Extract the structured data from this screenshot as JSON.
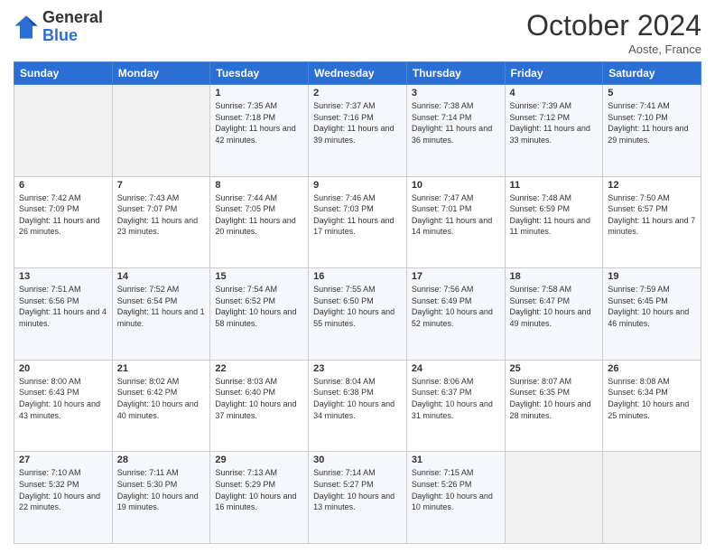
{
  "header": {
    "logo_line1": "General",
    "logo_line2": "Blue",
    "month": "October 2024",
    "location": "Aoste, France"
  },
  "weekdays": [
    "Sunday",
    "Monday",
    "Tuesday",
    "Wednesday",
    "Thursday",
    "Friday",
    "Saturday"
  ],
  "weeks": [
    [
      {
        "day": "",
        "sunrise": "",
        "sunset": "",
        "daylight": ""
      },
      {
        "day": "",
        "sunrise": "",
        "sunset": "",
        "daylight": ""
      },
      {
        "day": "1",
        "sunrise": "Sunrise: 7:35 AM",
        "sunset": "Sunset: 7:18 PM",
        "daylight": "Daylight: 11 hours and 42 minutes."
      },
      {
        "day": "2",
        "sunrise": "Sunrise: 7:37 AM",
        "sunset": "Sunset: 7:16 PM",
        "daylight": "Daylight: 11 hours and 39 minutes."
      },
      {
        "day": "3",
        "sunrise": "Sunrise: 7:38 AM",
        "sunset": "Sunset: 7:14 PM",
        "daylight": "Daylight: 11 hours and 36 minutes."
      },
      {
        "day": "4",
        "sunrise": "Sunrise: 7:39 AM",
        "sunset": "Sunset: 7:12 PM",
        "daylight": "Daylight: 11 hours and 33 minutes."
      },
      {
        "day": "5",
        "sunrise": "Sunrise: 7:41 AM",
        "sunset": "Sunset: 7:10 PM",
        "daylight": "Daylight: 11 hours and 29 minutes."
      }
    ],
    [
      {
        "day": "6",
        "sunrise": "Sunrise: 7:42 AM",
        "sunset": "Sunset: 7:09 PM",
        "daylight": "Daylight: 11 hours and 26 minutes."
      },
      {
        "day": "7",
        "sunrise": "Sunrise: 7:43 AM",
        "sunset": "Sunset: 7:07 PM",
        "daylight": "Daylight: 11 hours and 23 minutes."
      },
      {
        "day": "8",
        "sunrise": "Sunrise: 7:44 AM",
        "sunset": "Sunset: 7:05 PM",
        "daylight": "Daylight: 11 hours and 20 minutes."
      },
      {
        "day": "9",
        "sunrise": "Sunrise: 7:46 AM",
        "sunset": "Sunset: 7:03 PM",
        "daylight": "Daylight: 11 hours and 17 minutes."
      },
      {
        "day": "10",
        "sunrise": "Sunrise: 7:47 AM",
        "sunset": "Sunset: 7:01 PM",
        "daylight": "Daylight: 11 hours and 14 minutes."
      },
      {
        "day": "11",
        "sunrise": "Sunrise: 7:48 AM",
        "sunset": "Sunset: 6:59 PM",
        "daylight": "Daylight: 11 hours and 11 minutes."
      },
      {
        "day": "12",
        "sunrise": "Sunrise: 7:50 AM",
        "sunset": "Sunset: 6:57 PM",
        "daylight": "Daylight: 11 hours and 7 minutes."
      }
    ],
    [
      {
        "day": "13",
        "sunrise": "Sunrise: 7:51 AM",
        "sunset": "Sunset: 6:56 PM",
        "daylight": "Daylight: 11 hours and 4 minutes."
      },
      {
        "day": "14",
        "sunrise": "Sunrise: 7:52 AM",
        "sunset": "Sunset: 6:54 PM",
        "daylight": "Daylight: 11 hours and 1 minute."
      },
      {
        "day": "15",
        "sunrise": "Sunrise: 7:54 AM",
        "sunset": "Sunset: 6:52 PM",
        "daylight": "Daylight: 10 hours and 58 minutes."
      },
      {
        "day": "16",
        "sunrise": "Sunrise: 7:55 AM",
        "sunset": "Sunset: 6:50 PM",
        "daylight": "Daylight: 10 hours and 55 minutes."
      },
      {
        "day": "17",
        "sunrise": "Sunrise: 7:56 AM",
        "sunset": "Sunset: 6:49 PM",
        "daylight": "Daylight: 10 hours and 52 minutes."
      },
      {
        "day": "18",
        "sunrise": "Sunrise: 7:58 AM",
        "sunset": "Sunset: 6:47 PM",
        "daylight": "Daylight: 10 hours and 49 minutes."
      },
      {
        "day": "19",
        "sunrise": "Sunrise: 7:59 AM",
        "sunset": "Sunset: 6:45 PM",
        "daylight": "Daylight: 10 hours and 46 minutes."
      }
    ],
    [
      {
        "day": "20",
        "sunrise": "Sunrise: 8:00 AM",
        "sunset": "Sunset: 6:43 PM",
        "daylight": "Daylight: 10 hours and 43 minutes."
      },
      {
        "day": "21",
        "sunrise": "Sunrise: 8:02 AM",
        "sunset": "Sunset: 6:42 PM",
        "daylight": "Daylight: 10 hours and 40 minutes."
      },
      {
        "day": "22",
        "sunrise": "Sunrise: 8:03 AM",
        "sunset": "Sunset: 6:40 PM",
        "daylight": "Daylight: 10 hours and 37 minutes."
      },
      {
        "day": "23",
        "sunrise": "Sunrise: 8:04 AM",
        "sunset": "Sunset: 6:38 PM",
        "daylight": "Daylight: 10 hours and 34 minutes."
      },
      {
        "day": "24",
        "sunrise": "Sunrise: 8:06 AM",
        "sunset": "Sunset: 6:37 PM",
        "daylight": "Daylight: 10 hours and 31 minutes."
      },
      {
        "day": "25",
        "sunrise": "Sunrise: 8:07 AM",
        "sunset": "Sunset: 6:35 PM",
        "daylight": "Daylight: 10 hours and 28 minutes."
      },
      {
        "day": "26",
        "sunrise": "Sunrise: 8:08 AM",
        "sunset": "Sunset: 6:34 PM",
        "daylight": "Daylight: 10 hours and 25 minutes."
      }
    ],
    [
      {
        "day": "27",
        "sunrise": "Sunrise: 7:10 AM",
        "sunset": "Sunset: 5:32 PM",
        "daylight": "Daylight: 10 hours and 22 minutes."
      },
      {
        "day": "28",
        "sunrise": "Sunrise: 7:11 AM",
        "sunset": "Sunset: 5:30 PM",
        "daylight": "Daylight: 10 hours and 19 minutes."
      },
      {
        "day": "29",
        "sunrise": "Sunrise: 7:13 AM",
        "sunset": "Sunset: 5:29 PM",
        "daylight": "Daylight: 10 hours and 16 minutes."
      },
      {
        "day": "30",
        "sunrise": "Sunrise: 7:14 AM",
        "sunset": "Sunset: 5:27 PM",
        "daylight": "Daylight: 10 hours and 13 minutes."
      },
      {
        "day": "31",
        "sunrise": "Sunrise: 7:15 AM",
        "sunset": "Sunset: 5:26 PM",
        "daylight": "Daylight: 10 hours and 10 minutes."
      },
      {
        "day": "",
        "sunrise": "",
        "sunset": "",
        "daylight": ""
      },
      {
        "day": "",
        "sunrise": "",
        "sunset": "",
        "daylight": ""
      }
    ]
  ]
}
